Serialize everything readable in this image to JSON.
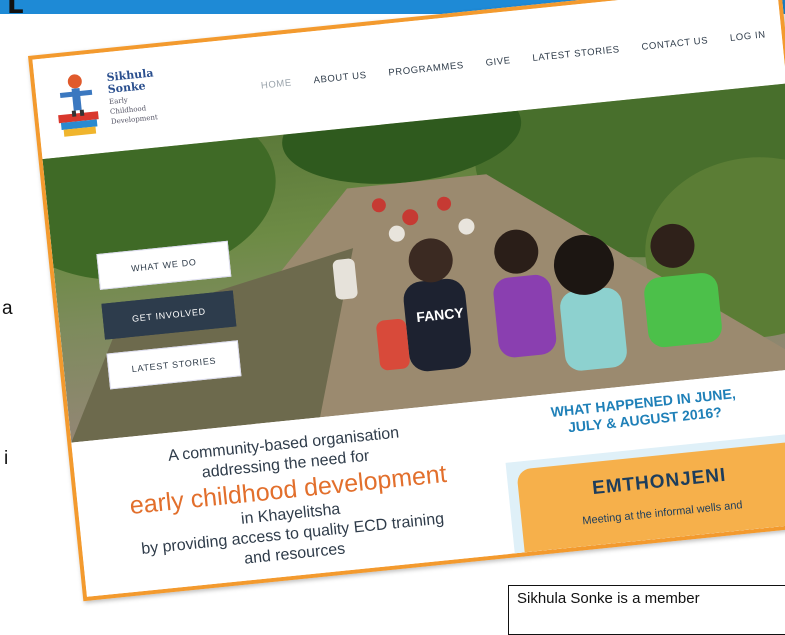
{
  "page": {
    "heading_fragment": "L",
    "side_fragments": [
      "a",
      "i"
    ]
  },
  "site": {
    "logo": {
      "line1": "Sikhula",
      "line2": "Sonke",
      "sub1": "Early",
      "sub2": "Childhood",
      "sub3": "Development"
    },
    "nav": [
      {
        "label": "HOME",
        "active": true
      },
      {
        "label": "ABOUT US"
      },
      {
        "label": "PROGRAMMES"
      },
      {
        "label": "GIVE"
      },
      {
        "label": "LATEST STORIES"
      },
      {
        "label": "CONTACT US"
      },
      {
        "label": "LOG IN"
      }
    ],
    "hero_buttons": [
      "WHAT WE DO",
      "GET INVOLVED",
      "LATEST STORIES"
    ],
    "hero_shirt_text": "FANCY",
    "mission": {
      "line1": "A community-based organisation",
      "line2": "addressing the need for",
      "line3": "early childhood development",
      "line4": "in Khayelitsha",
      "line5": "by providing access to quality ECD training",
      "line6": "and resources"
    },
    "happened": {
      "line1": "WHAT HAPPENED IN JUNE,",
      "line2": "JULY & AUGUST 2016?"
    },
    "emthonjeni": {
      "title": "EMTHONJENI",
      "text": "Meeting at the informal wells and"
    }
  },
  "caption": "Sikhula Sonke is a member",
  "colors": {
    "frame": "#f39a2e",
    "band": "#1e8ad6",
    "accent_orange": "#e26f2c",
    "nav_text": "#2f3c4a",
    "button_dark": "#2d3c4c",
    "card": "#f6b04b"
  }
}
